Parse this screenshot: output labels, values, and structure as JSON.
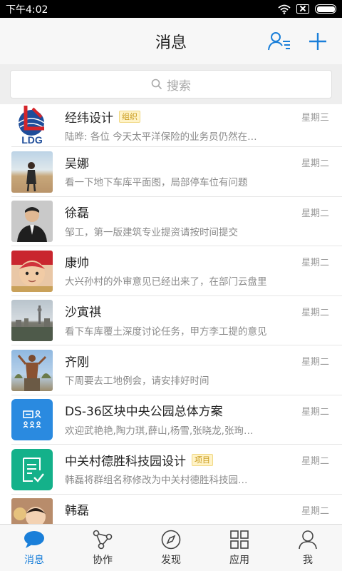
{
  "status_bar": {
    "time": "下午4:02"
  },
  "header": {
    "title": "消息"
  },
  "search": {
    "placeholder": "搜索"
  },
  "conversations": [
    {
      "name": "经纬设计",
      "tag": "组织",
      "time": "星期三",
      "preview": "陆晔: 各位 今天太平洋保险的业务员仍然在…"
    },
    {
      "name": "吴娜",
      "tag": "",
      "time": "星期二",
      "preview": "看一下地下车库平面图，局部停车位有问题"
    },
    {
      "name": "徐磊",
      "tag": "",
      "time": "星期二",
      "preview": "邹工，第一版建筑专业提资请按时间提交"
    },
    {
      "name": "康帅",
      "tag": "",
      "time": "星期二",
      "preview": "大兴孙村的外审意见已经出来了，在部门云盘里"
    },
    {
      "name": "沙寅祺",
      "tag": "",
      "time": "星期二",
      "preview": "看下车库覆土深度讨论任务，甲方李工提的意见"
    },
    {
      "name": "齐刚",
      "tag": "",
      "time": "星期二",
      "preview": "下周要去工地例会，请安排好时间"
    },
    {
      "name": "DS-36区块中央公园总体方案",
      "tag": "",
      "time": "星期二",
      "preview": "欢迎武艳艳,陶力琪,薛山,杨雪,张晓龙,张珣…"
    },
    {
      "name": "中关村德胜科技园设计",
      "tag": "项目",
      "time": "星期二",
      "preview": "韩磊将群组名称修改为中关村德胜科技园…"
    },
    {
      "name": "韩磊",
      "tag": "",
      "time": "星期二",
      "preview": ""
    }
  ],
  "logo_text": "LDG",
  "tabs": [
    {
      "label": "消息",
      "icon": "chat-bubble-icon",
      "active": true
    },
    {
      "label": "协作",
      "icon": "share-nodes-icon",
      "active": false
    },
    {
      "label": "发现",
      "icon": "compass-icon",
      "active": false
    },
    {
      "label": "应用",
      "icon": "grid-icon",
      "active": false
    },
    {
      "label": "我",
      "icon": "person-icon",
      "active": false
    }
  ],
  "colors": {
    "accent": "#1a7fd9",
    "tag_fg": "#c89a1c",
    "tag_bg": "#fff3c8"
  }
}
